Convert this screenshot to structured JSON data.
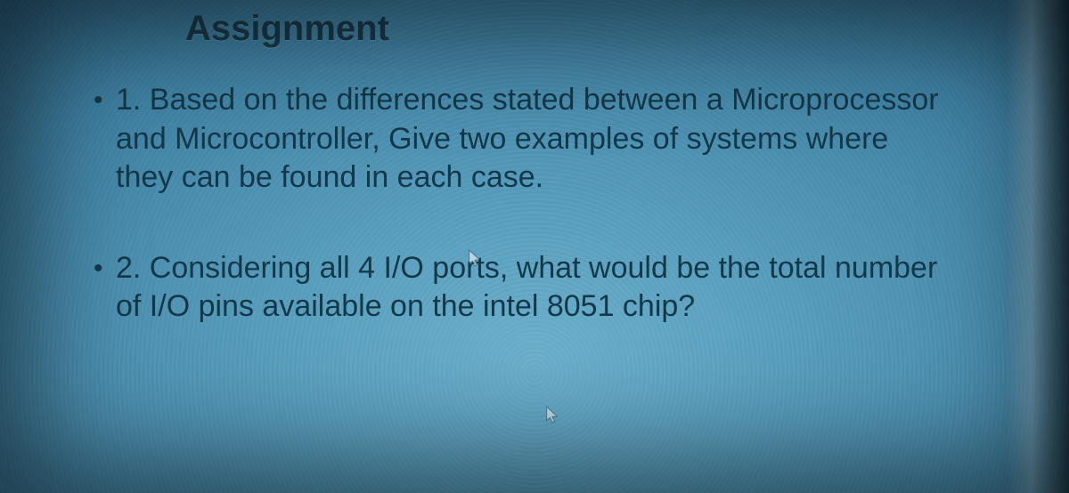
{
  "slide": {
    "title": "Assignment",
    "items": [
      "1. Based on the differences stated between a Microprocessor and Microcontroller, Give two examples of systems where they can be found in each case.",
      "2. Considering all  4  I/O ports, what would be the total number of I/O pins available on the intel 8051 chip?"
    ]
  },
  "colors": {
    "heading": "#1a3a4a",
    "body": "#133849",
    "bg_center": "#6db0cc",
    "bg_edge": "#0e2e44"
  },
  "icons": {
    "cursor": "pointer-cursor-icon"
  }
}
